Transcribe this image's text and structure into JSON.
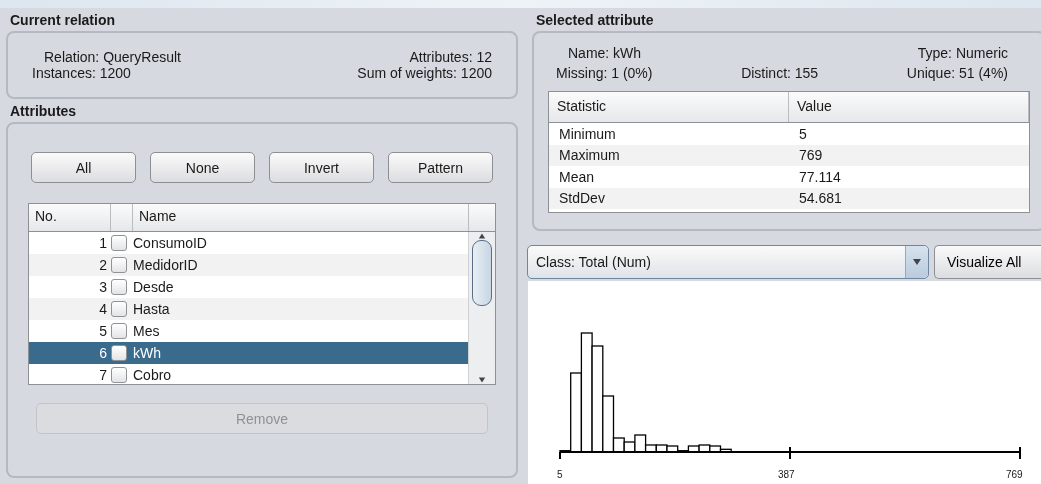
{
  "current_relation": {
    "title": "Current relation",
    "relation": "Relation: QueryResult",
    "attributes": "Attributes: 12",
    "instances": "Instances: 1200",
    "sum_of_weights": "Sum of weights: 1200"
  },
  "attributes": {
    "title": "Attributes",
    "buttons": [
      "All",
      "None",
      "Invert",
      "Pattern"
    ],
    "columns": [
      "No.",
      "Name"
    ],
    "rows": [
      {
        "no": "1",
        "name": "ConsumoID",
        "checked": false,
        "selected": false
      },
      {
        "no": "2",
        "name": "MedidorID",
        "checked": false,
        "selected": false
      },
      {
        "no": "3",
        "name": "Desde",
        "checked": false,
        "selected": false
      },
      {
        "no": "4",
        "name": "Hasta",
        "checked": false,
        "selected": false
      },
      {
        "no": "5",
        "name": "Mes",
        "checked": false,
        "selected": false
      },
      {
        "no": "6",
        "name": "kWh",
        "checked": false,
        "selected": true
      },
      {
        "no": "7",
        "name": "Cobro",
        "checked": false,
        "selected": false
      }
    ],
    "remove_button": {
      "label": "Remove",
      "disabled": true
    }
  },
  "selected_attribute": {
    "title": "Selected attribute",
    "name": "Name: kWh",
    "type": "Type: Numeric",
    "missing": "Missing: 1 (0%)",
    "distinct": "Distinct: 155",
    "unique": "Unique: 51 (4%)",
    "columns": [
      "Statistic",
      "Value"
    ],
    "rows": [
      [
        "Minimum",
        "5"
      ],
      [
        "Maximum",
        "769"
      ],
      [
        "Mean",
        "77.114"
      ],
      [
        "StdDev",
        "54.681"
      ]
    ]
  },
  "class_dropdown": {
    "value": "Class: Total (Num)"
  },
  "visualize_button": "Visualize All",
  "histogram": {
    "axis_labels": [
      "5",
      "387",
      "769"
    ]
  }
}
